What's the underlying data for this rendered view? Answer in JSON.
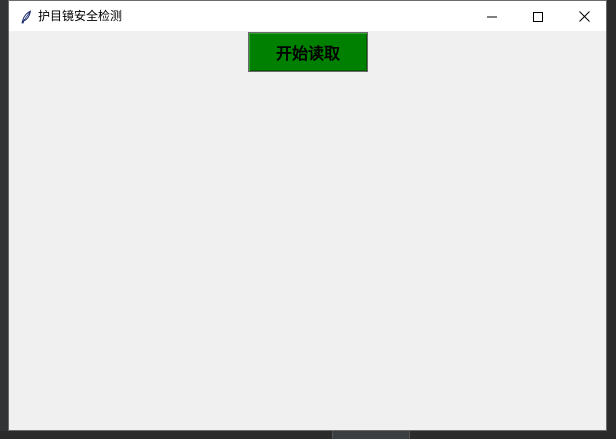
{
  "window": {
    "title": "护目镜安全检测",
    "icon": "feather-icon",
    "controls": {
      "minimize": "minimize-icon",
      "maximize": "maximize-icon",
      "close": "close-icon"
    }
  },
  "main": {
    "start_button_label": "开始读取",
    "start_button_color": "#008000"
  },
  "colors": {
    "client_background": "#f0f0f0",
    "titlebar_background": "#ffffff",
    "backdrop": "#2b2b2b"
  }
}
